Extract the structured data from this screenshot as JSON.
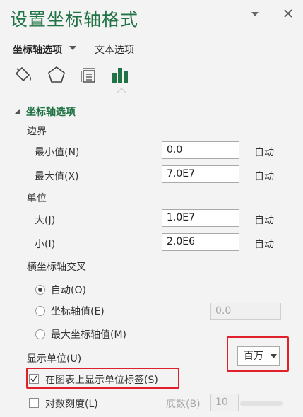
{
  "pane": {
    "title": "设置坐标轴格式"
  },
  "tabs": {
    "axis_options": "坐标轴选项",
    "text_options": "文本选项"
  },
  "icons": [
    "fill-line-icon",
    "effects-icon",
    "size-properties-icon",
    "axis-options-icon"
  ],
  "accent_color": "#217346",
  "section": {
    "title": "坐标轴选项"
  },
  "bounds": {
    "heading": "边界",
    "min": {
      "label": "最小值(N)",
      "value": "0.0",
      "auto": "自动"
    },
    "max": {
      "label": "最大值(X)",
      "value": "7.0E7",
      "auto": "自动"
    }
  },
  "units": {
    "heading": "单位",
    "major": {
      "label": "大(J)",
      "value": "1.0E7",
      "auto": "自动"
    },
    "minor": {
      "label": "小(I)",
      "value": "2.0E6",
      "auto": "自动"
    }
  },
  "crosses": {
    "heading": "横坐标轴交叉",
    "auto": {
      "label": "自动(O)",
      "selected": true
    },
    "axis_value": {
      "label": "坐标轴值(E)",
      "value": "0.0",
      "selected": false
    },
    "max_value": {
      "label": "最大坐标轴值(M)",
      "selected": false
    }
  },
  "display_units": {
    "label": "显示单位(U)",
    "value": "百万"
  },
  "show_label": {
    "label": "在图表上显示单位标签(S)",
    "checked": true
  },
  "log_scale": {
    "label": "对数刻度(L)",
    "checked": false,
    "base_label": "底数(B)",
    "base_value": "10"
  }
}
